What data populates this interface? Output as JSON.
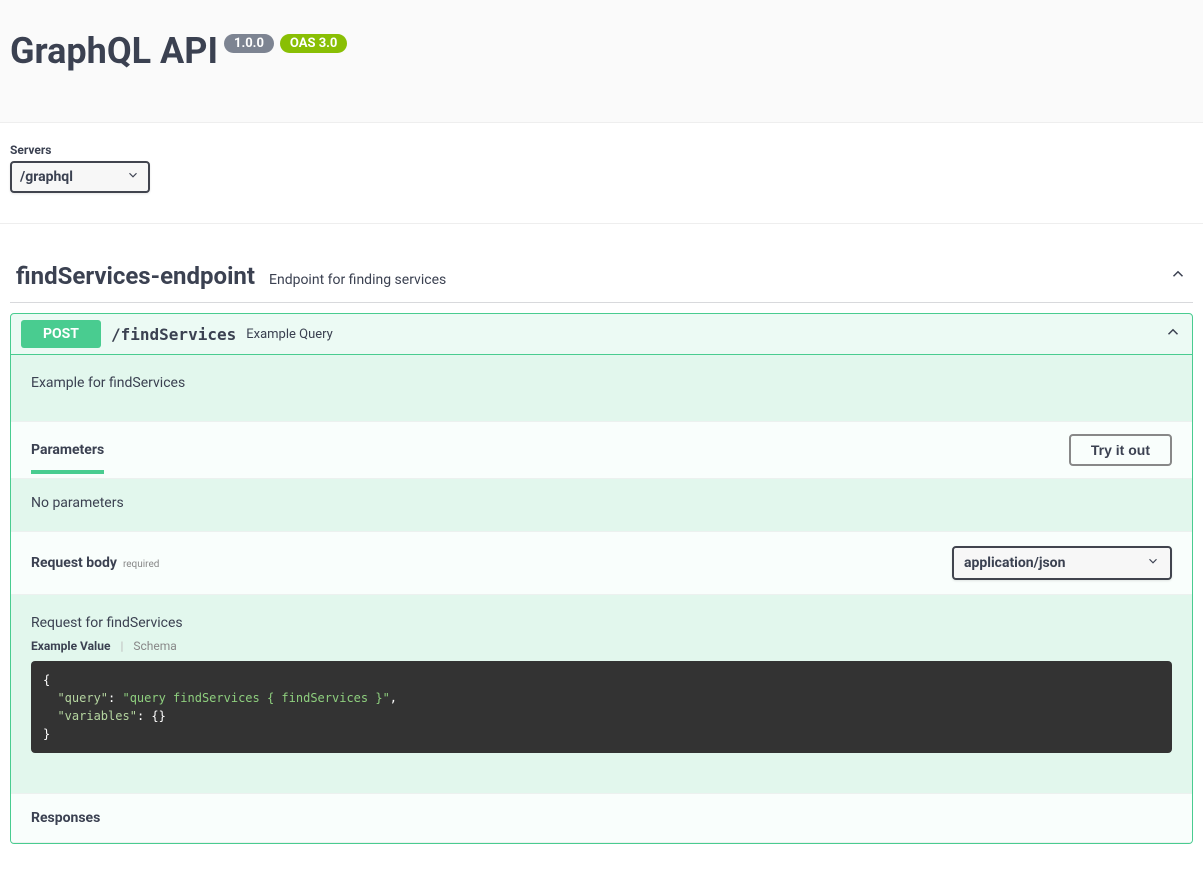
{
  "header": {
    "title": "GraphQL API",
    "version": "1.0.0",
    "oas": "OAS 3.0"
  },
  "servers": {
    "label": "Servers",
    "selected": "/graphql"
  },
  "tag": {
    "name": "findServices-endpoint",
    "description": "Endpoint for finding services"
  },
  "operation": {
    "method": "POST",
    "path": "/findServices",
    "summary": "Example Query",
    "description": "Example for findServices",
    "parameters_tab": "Parameters",
    "try_it_out": "Try it out",
    "no_parameters": "No parameters",
    "request_body_label": "Request body",
    "request_body_required": "required",
    "content_type": "application/json",
    "request_body_description": "Request for findServices",
    "example_tab": "Example Value",
    "schema_tab": "Schema",
    "code": {
      "line1_open": "{",
      "line2_key": "\"query\"",
      "line2_colon": ": ",
      "line2_val": "\"query findServices { findServices }\"",
      "line2_comma": ",",
      "line3_key": "\"variables\"",
      "line3_colon": ": ",
      "line3_val": "{}",
      "line4_close": "}"
    },
    "responses_label": "Responses"
  }
}
